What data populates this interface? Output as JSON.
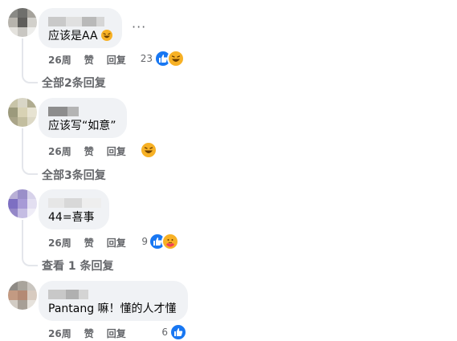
{
  "comments": [
    {
      "text": "应该是AA",
      "time": "26周",
      "like_label": "赞",
      "reply_label": "回复",
      "reaction_count": "23",
      "reactions": [
        "like-icon",
        "haha-icon"
      ],
      "replies_link": "全部2条回复",
      "text_emoji": "haha-emoji"
    },
    {
      "text": "应该写“如意”",
      "time": "26周",
      "like_label": "赞",
      "reply_label": "回复",
      "reaction_count": "",
      "reactions": [
        "haha-icon"
      ],
      "replies_link": "全部3条回复"
    },
    {
      "text": "44=喜事",
      "time": "26周",
      "like_label": "赞",
      "reply_label": "回复",
      "reaction_count": "9",
      "reactions": [
        "like-icon",
        "care-icon"
      ],
      "replies_link": "查看 1 条回复"
    },
    {
      "text": "Pantang 嘛！懂的人才懂",
      "time": "26周",
      "like_label": "赞",
      "reply_label": "回复",
      "reaction_count": "6",
      "reactions": [
        "like-icon"
      ]
    }
  ],
  "more_icon": "more-options-icon",
  "more_glyph": "···",
  "colors": {
    "bubble": "#f0f2f5",
    "meta_text": "#65676b",
    "like_blue": "#1877f2",
    "haha_yellow": "#f7b125"
  }
}
